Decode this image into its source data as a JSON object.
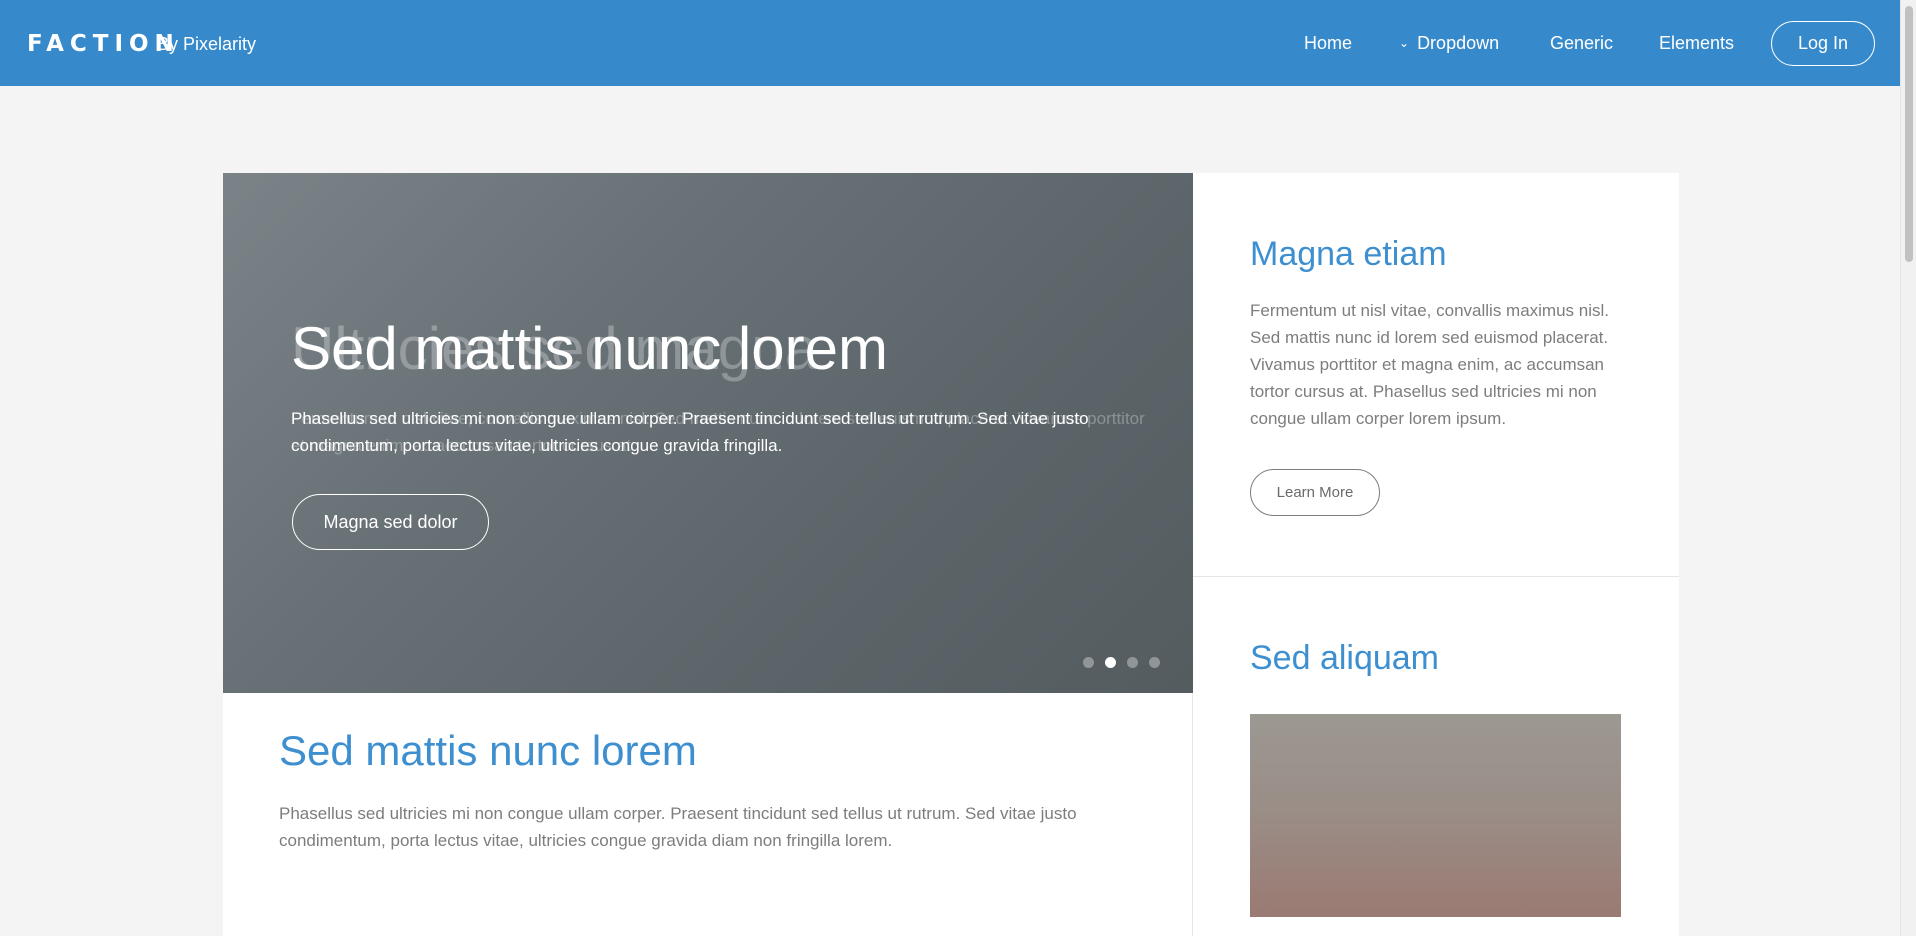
{
  "header": {
    "logo": "FACTION",
    "byline": "By Pixelarity",
    "nav": {
      "home": "Home",
      "dropdown": "Dropdown",
      "generic": "Generic",
      "elements": "Elements",
      "login": "Log In"
    }
  },
  "slider": {
    "ghost_title": "Ultricies sed magna",
    "title": "Sed mattis nunc lorem",
    "ghost_text": "Fermentum ut nisl vitae, convallis maximus nisl. Sed mattis nunc id lorem sed euismod placerat. Vivamus porttitor et magna enim, ac accumsan tortor cursus at.",
    "text": "Phasellus sed ultricies mi non congue ullam corper. Praesent tincidunt sed tellus ut rutrum. Sed vitae justo condimentum, porta lectus vitae, ultricies congue gravida fringilla.",
    "button": "Magna sed dolor",
    "active_dot": 1
  },
  "article": {
    "title": "Sed mattis nunc lorem",
    "text": "Phasellus sed ultricies mi non congue ullam corper. Praesent tincidunt sed tellus ut rutrum. Sed vitae justo condimentum, porta lectus vitae, ultricies congue gravida diam non fringilla lorem."
  },
  "sidebar": {
    "top": {
      "title": "Magna etiam",
      "text": "Fermentum ut nisl vitae, convallis maximus nisl. Sed mattis nunc id lorem sed euismod placerat. Vivamus porttitor et magna enim, ac accumsan tortor cursus at. Phasellus sed ultricies mi non congue ullam corper lorem ipsum.",
      "button": "Learn More"
    },
    "bottom": {
      "title": "Sed aliquam"
    }
  },
  "colors": {
    "header_bg": "#368acb",
    "accent": "#3d8fd0",
    "body_text": "#7d7d7d"
  }
}
